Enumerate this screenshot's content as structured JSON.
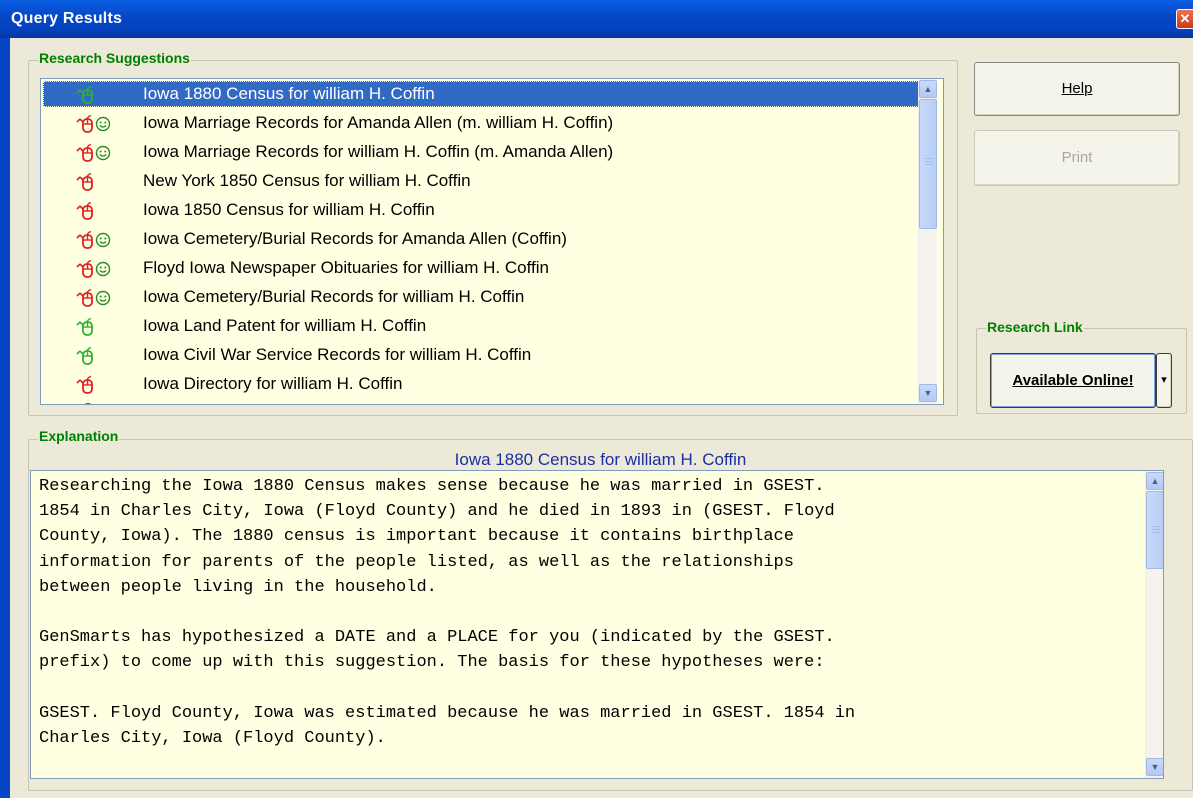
{
  "window": {
    "title": "Query Results",
    "close_glyph": "✕"
  },
  "suggestions": {
    "legend": "Research Suggestions",
    "items": [
      {
        "label": "Iowa 1880 Census for william H. Coffin",
        "mouse_color": "#2fb02f",
        "smile": false,
        "selected": true
      },
      {
        "label": "Iowa Marriage Records for Amanda Allen (m. william H. Coffin)",
        "mouse_color": "#e02020",
        "smile": true,
        "selected": false
      },
      {
        "label": "Iowa Marriage Records for william H. Coffin (m. Amanda Allen)",
        "mouse_color": "#e02020",
        "smile": true,
        "selected": false
      },
      {
        "label": "New York 1850 Census for william H. Coffin",
        "mouse_color": "#e02020",
        "smile": false,
        "selected": false
      },
      {
        "label": "Iowa 1850 Census for william H. Coffin",
        "mouse_color": "#e02020",
        "smile": false,
        "selected": false
      },
      {
        "label": "Iowa Cemetery/Burial Records for Amanda Allen (Coffin)",
        "mouse_color": "#e02020",
        "smile": true,
        "selected": false
      },
      {
        "label": "Floyd Iowa Newspaper Obituaries for william H. Coffin",
        "mouse_color": "#e02020",
        "smile": true,
        "selected": false
      },
      {
        "label": "Iowa Cemetery/Burial Records for william H. Coffin",
        "mouse_color": "#e02020",
        "smile": true,
        "selected": false
      },
      {
        "label": "Iowa Land Patent for william H. Coffin",
        "mouse_color": "#2fb02f",
        "smile": false,
        "selected": false
      },
      {
        "label": "Iowa Civil War Service Records for william H. Coffin",
        "mouse_color": "#2fb02f",
        "smile": false,
        "selected": false
      },
      {
        "label": "Iowa Directory for william H. Coffin",
        "mouse_color": "#e02020",
        "smile": false,
        "selected": false
      }
    ]
  },
  "buttons": {
    "help": "Help",
    "print": "Print"
  },
  "research_link": {
    "legend": "Research Link",
    "button": "Available Online!"
  },
  "explanation": {
    "legend": "Explanation",
    "title": "Iowa 1880 Census for william H. Coffin",
    "lines": [
      "Researching the Iowa 1880 Census makes sense because he was married in GSEST.",
      "1854 in Charles City, Iowa (Floyd County) and he died in 1893 in (GSEST. Floyd",
      "County, Iowa). The 1880 census is important because it contains birthplace",
      "information for parents of the people listed, as well as the relationships",
      "between people living in the household.",
      "",
      "GenSmarts has hypothesized a DATE and a PLACE for you (indicated by the GSEST.",
      "prefix) to come up with this suggestion. The basis for these hypotheses were:",
      "",
      "GSEST. Floyd County, Iowa was estimated because he was married in GSEST. 1854 in",
      "Charles City, Iowa (Floyd County)."
    ]
  },
  "icons": {
    "mouse": "mouse-icon",
    "smile": "smiley-icon",
    "scroll_up": "▲",
    "scroll_down": "▼",
    "dropdown": "▾"
  }
}
